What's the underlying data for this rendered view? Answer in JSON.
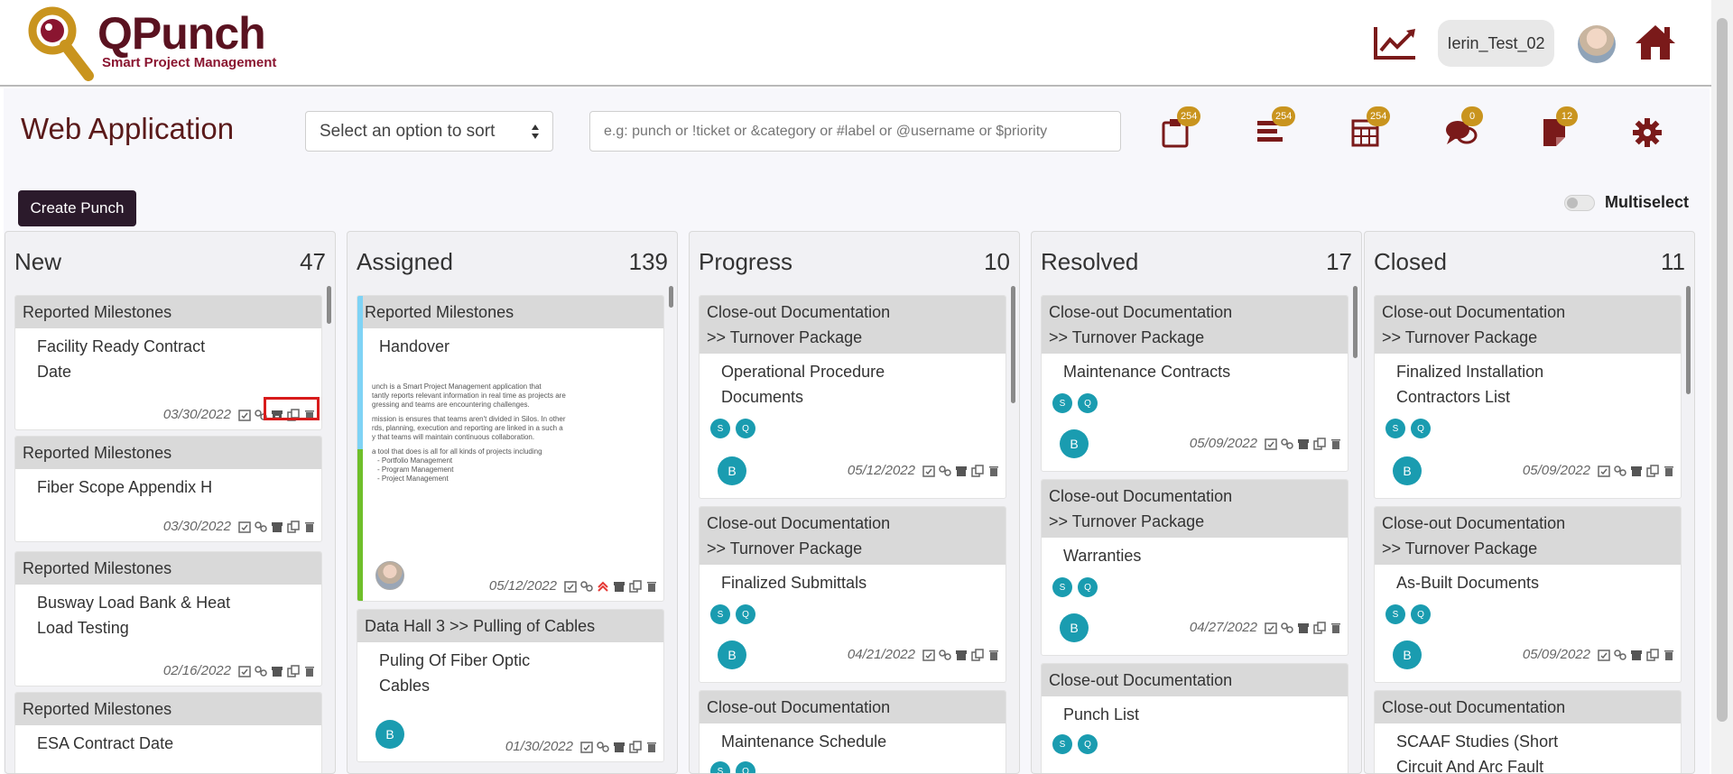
{
  "header": {
    "logo_title": "QPunch",
    "logo_subtitle": "Smart Project Management",
    "username": "Ierin_Test_02",
    "icons": [
      "analytics-icon",
      "avatar",
      "home-icon"
    ]
  },
  "toolbar": {
    "page_title": "Web Application",
    "sort_placeholder": "Select an option to sort",
    "search_placeholder": "e.g: punch or !ticket or &category or #label or @username or $priority",
    "badges": {
      "clipboard": "254",
      "list": "254",
      "calendar": "254",
      "chat": "0",
      "notes": "12"
    },
    "create_label": "Create Punch",
    "multiselect_label": "Multiselect"
  },
  "columns": [
    {
      "title": "New",
      "count": "47",
      "cards": [
        {
          "head": "Reported Milestones",
          "title": "Facility Ready Contract Date",
          "date": "03/30/2022"
        },
        {
          "head": "Reported Milestones",
          "title": "Fiber Scope Appendix H",
          "date": "03/30/2022"
        },
        {
          "head": "Reported Milestones",
          "title": "Busway Load Bank & Heat Load Testing",
          "date": "02/16/2022"
        },
        {
          "head": "Reported Milestones",
          "title": "ESA Contract Date",
          "date": ""
        }
      ]
    },
    {
      "title": "Assigned",
      "count": "139",
      "cards": [
        {
          "head": "Reported Milestones",
          "title": "Handover",
          "date": "05/12/2022",
          "preview": [
            "unch is a Smart Project Management application that",
            "tantly reports relevant information in real time as projects are",
            "gressing and teams are encountering challenges.",
            "mission is ensures that teams aren't divided in Silos. In other",
            "rds, planning, execution and reporting are linked in a such a",
            "y that teams will maintain continuous collaboration.",
            "a tool that does is all for all kinds of projects including",
            "- Portfolio Management",
            "- Program Management",
            "- Project Management"
          ]
        },
        {
          "head": "Data Hall 3 >>   Pulling of Cables",
          "title": "Puling Of Fiber Optic Cables",
          "date": "01/30/2022",
          "avatar": "B"
        }
      ]
    },
    {
      "title": "Progress",
      "count": "10",
      "cards": [
        {
          "head1": "Close-out Documentation",
          "head2": ">>   Turnover Package",
          "title": "Operational Procedure Documents",
          "date": "05/12/2022",
          "avatar": "B",
          "chips": [
            "S",
            "Q"
          ]
        },
        {
          "head1": "Close-out Documentation",
          "head2": ">>   Turnover Package",
          "title": "Finalized Submittals",
          "date": "04/21/2022",
          "avatar": "B",
          "chips": [
            "S",
            "Q"
          ]
        },
        {
          "head1": "Close-out Documentation",
          "title": "Maintenance Schedule",
          "chips": [
            "S",
            "Q"
          ]
        }
      ]
    },
    {
      "title": "Resolved",
      "count": "17",
      "cards": [
        {
          "head1": "Close-out Documentation",
          "head2": ">>   Turnover Package",
          "title": "Maintenance Contracts",
          "date": "05/09/2022",
          "avatar": "B",
          "chips": [
            "S",
            "Q"
          ]
        },
        {
          "head1": "Close-out Documentation",
          "head2": ">>   Turnover Package",
          "title": "Warranties",
          "date": "04/27/2022",
          "avatar": "B",
          "chips": [
            "S",
            "Q"
          ]
        },
        {
          "head1": "Close-out Documentation",
          "title": "Punch List",
          "chips": [
            "S",
            "Q"
          ]
        }
      ]
    },
    {
      "title": "Closed",
      "count": "11",
      "cards": [
        {
          "head1": "Close-out Documentation",
          "head2": ">>   Turnover Package",
          "title": "Finalized Installation Contractors List",
          "date": "05/09/2022",
          "avatar": "B",
          "chips": [
            "S",
            "Q"
          ]
        },
        {
          "head1": "Close-out Documentation",
          "head2": ">>   Turnover Package",
          "title": "As-Built Documents",
          "date": "05/09/2022",
          "avatar": "B",
          "chips": [
            "S",
            "Q"
          ]
        },
        {
          "head1": "Close-out Documentation",
          "title": "SCAAF Studies (Short Circuit And Arc Fault"
        }
      ]
    }
  ],
  "colors": {
    "brand": "#5a1220",
    "accent_gold": "#c9941e",
    "chip": "#1a9cb0",
    "create_button": "#2b1a2b",
    "highlight": "#d81b1b"
  }
}
